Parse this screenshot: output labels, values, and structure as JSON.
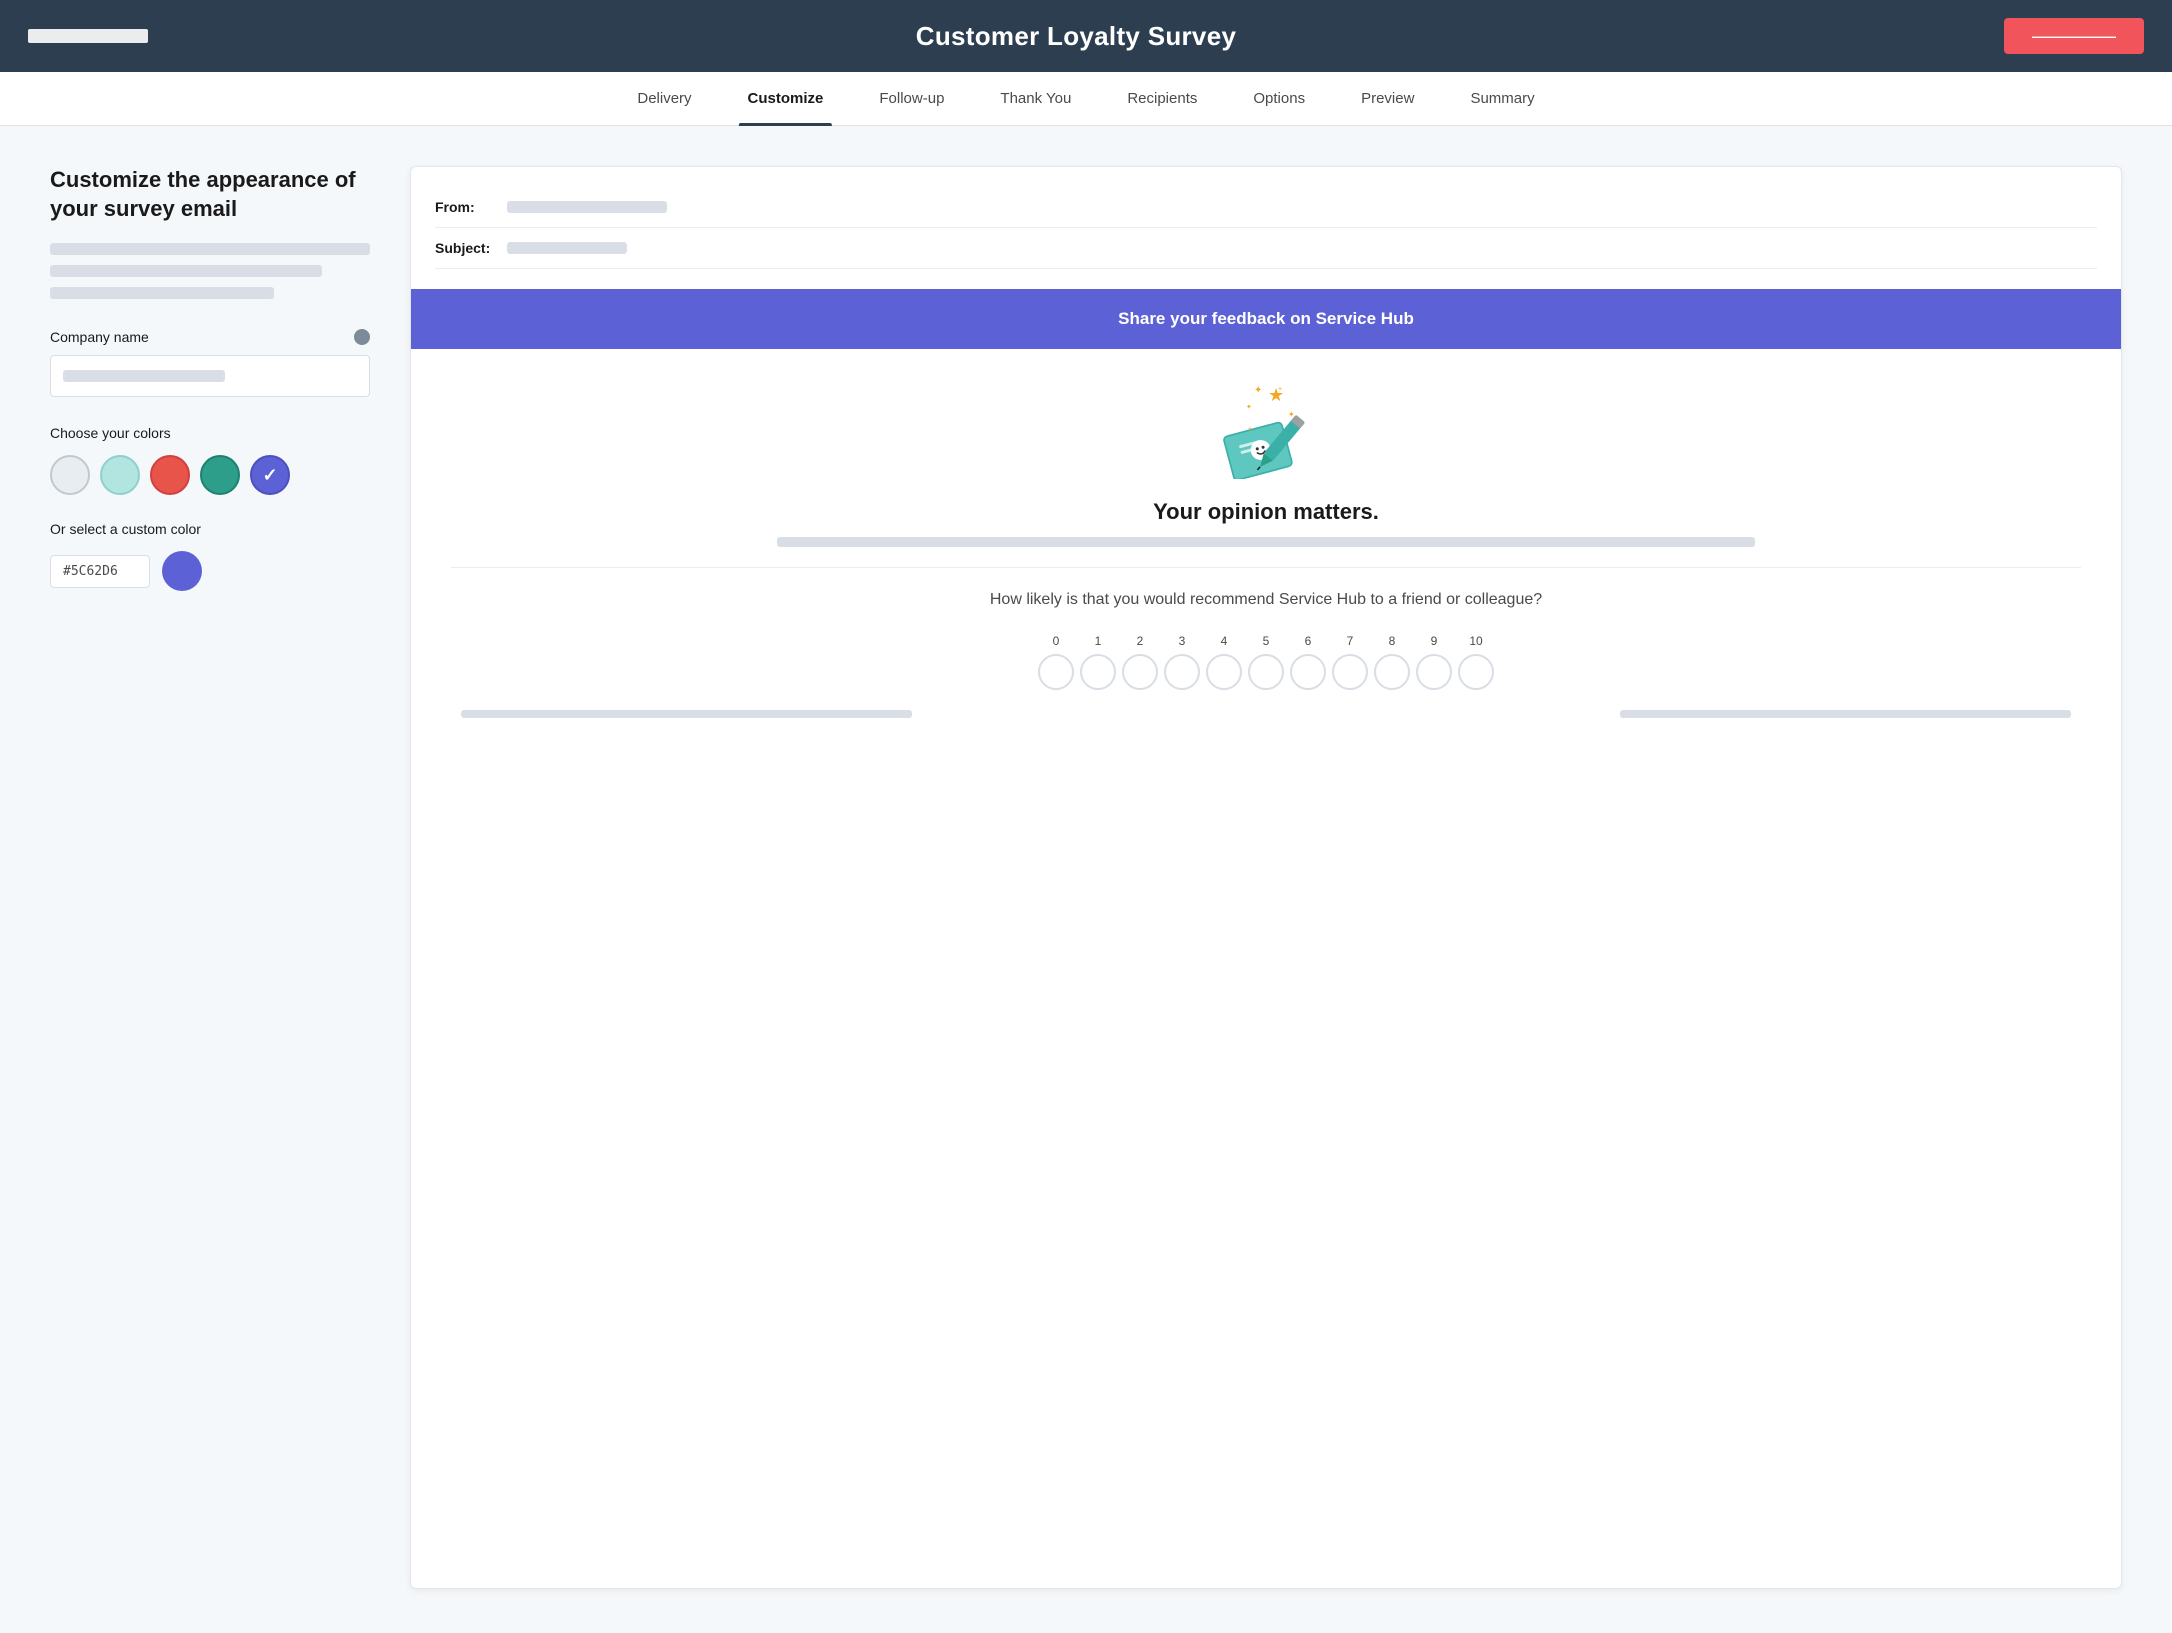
{
  "header": {
    "logo_alt": "HubSpot logo",
    "title": "Customer Loyalty Survey",
    "button_label": "——————"
  },
  "nav": {
    "tabs": [
      {
        "label": "Delivery",
        "active": false
      },
      {
        "label": "Customize",
        "active": true
      },
      {
        "label": "Follow-up",
        "active": false
      },
      {
        "label": "Thank You",
        "active": false
      },
      {
        "label": "Recipients",
        "active": false
      },
      {
        "label": "Options",
        "active": false
      },
      {
        "label": "Preview",
        "active": false
      },
      {
        "label": "Summary",
        "active": false
      }
    ]
  },
  "left": {
    "title": "Customize the appearance of your survey email",
    "company_name_label": "Company name",
    "company_name_placeholder": "",
    "colors_label": "Choose your colors",
    "colors": [
      {
        "hex": "#e8edf2",
        "selected": false,
        "name": "light-gray"
      },
      {
        "hex": "#b2e4e0",
        "selected": false,
        "name": "teal-light"
      },
      {
        "hex": "#e8544a",
        "selected": false,
        "name": "red"
      },
      {
        "hex": "#2c9e8a",
        "selected": false,
        "name": "teal-dark"
      },
      {
        "hex": "#5c62d6",
        "selected": true,
        "name": "purple"
      }
    ],
    "custom_color_label": "Or select a custom color",
    "hex_value": "#5C62D6",
    "custom_color_hex": "#5c62d6"
  },
  "email_preview": {
    "from_label": "From:",
    "subject_label": "Subject:",
    "banner_text": "Share your feedback on Service Hub",
    "headline": "Your opinion matters.",
    "question": "How likely is that you would recommend Service Hub to a friend or colleague?",
    "nps_labels": [
      "0",
      "1",
      "2",
      "3",
      "4",
      "5",
      "6",
      "7",
      "8",
      "9",
      "10"
    ]
  }
}
